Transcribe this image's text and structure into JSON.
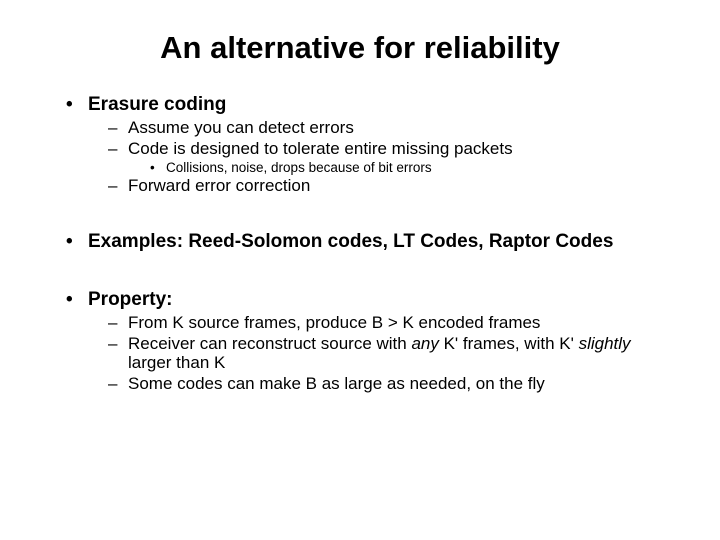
{
  "title": "An alternative for reliability",
  "b1": {
    "heading": "Erasure coding",
    "s1": "Assume you can detect errors",
    "s2": "Code is designed to tolerate entire missing packets",
    "s2a": "Collisions, noise, drops because of bit errors",
    "s3": "Forward error correction"
  },
  "b2": {
    "heading": "Examples: Reed-Solomon codes, LT Codes, Raptor Codes"
  },
  "b3": {
    "heading": "Property:",
    "s1": "From K source frames, produce B > K encoded frames",
    "s2a": "Receiver can reconstruct source with ",
    "s2b": "any",
    "s2c": " K' frames, with K' ",
    "s2d": "slightly",
    "s2e": " larger than K",
    "s3": "Some codes can make B as large as needed, on the fly"
  }
}
